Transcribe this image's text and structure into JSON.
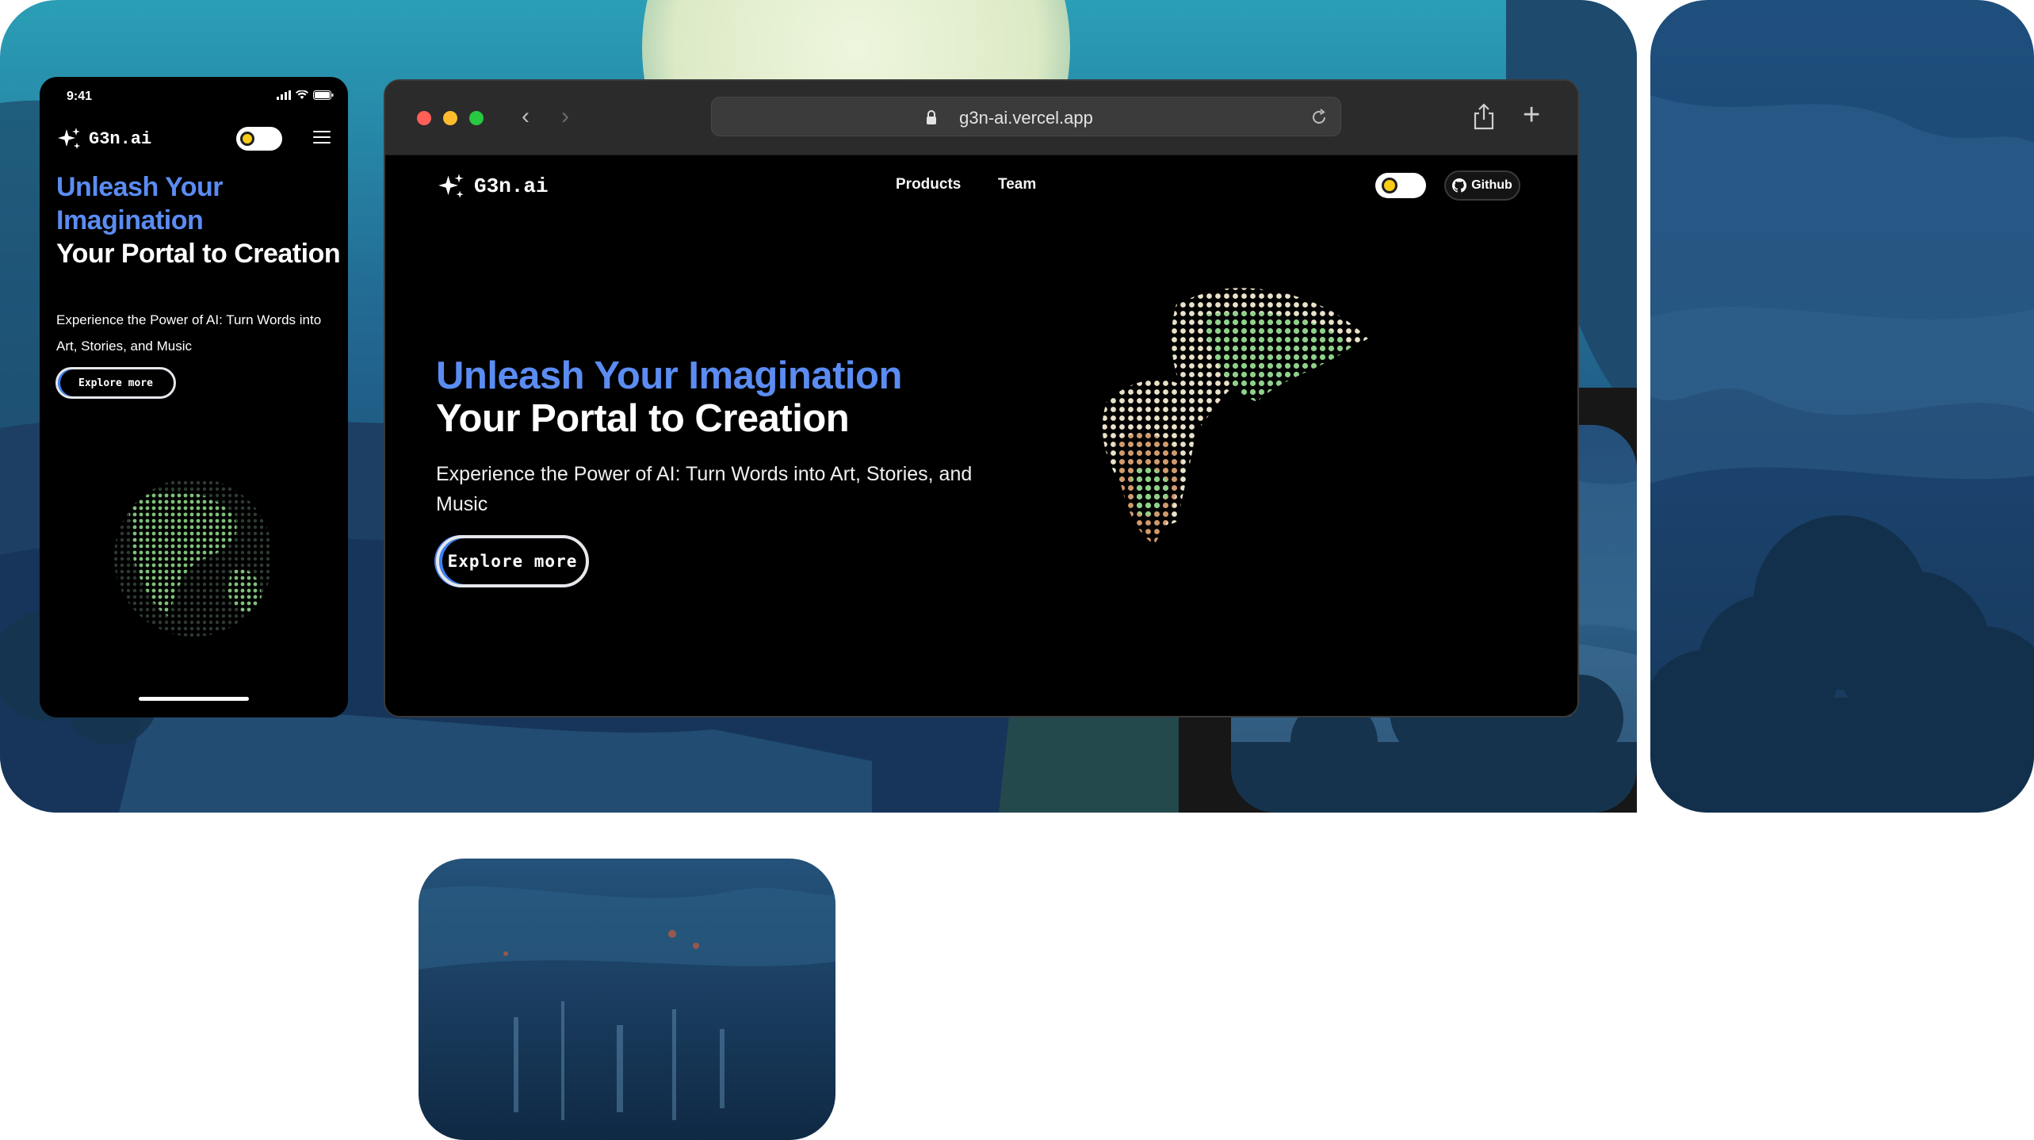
{
  "phone": {
    "status_time": "9:41",
    "brand": "G3n.ai",
    "headline_accent": "Unleash Your Imagination",
    "headline_main": "Your Portal to Creation",
    "subtitle": "Experience the Power of AI: Turn Words into Art, Stories, and Music",
    "cta_label": "Explore more"
  },
  "browser": {
    "url": "g3n-ai.vercel.app",
    "brand": "G3n.ai",
    "nav": [
      "Products",
      "Team"
    ],
    "github_label": "Github",
    "headline_accent": "Unleash Your Imagination",
    "headline_main": "Your Portal to Creation",
    "subtitle": "Experience the Power of AI: Turn Words into Art, Stories, and Music",
    "cta_label": "Explore more"
  },
  "colors": {
    "accent_blue": "#5b8cf2",
    "toggle_sun": "#facc15",
    "traffic_red": "#ff5f57",
    "traffic_yellow": "#febc2e",
    "traffic_green": "#28c840"
  }
}
